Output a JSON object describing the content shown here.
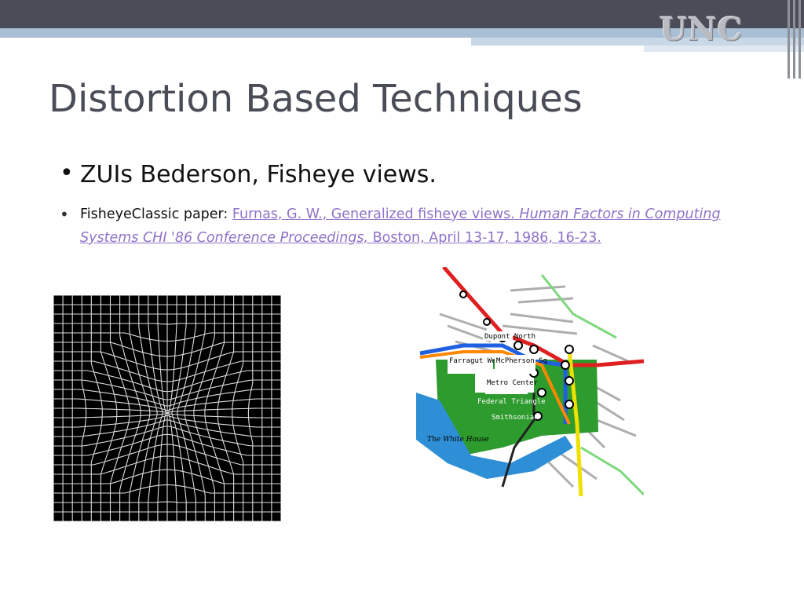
{
  "header": {
    "logo_text": "UNC"
  },
  "slide": {
    "title": "Distortion Based Techniques",
    "bullet1": "ZUIs  Bederson, Fisheye views.",
    "bullet2": {
      "prefix": "FisheyeClassic paper:  ",
      "link_part1": "Furnas, G. W., Generalized fisheye views. ",
      "link_part2_italic": "Human Factors in Computing Systems CHI '86 Conference Proceedings,",
      "link_part3": " Boston, April 13-17, 1986, 16-23."
    }
  },
  "images": {
    "metro_labels": {
      "north": "Dupont North",
      "farragut": "Farragut West",
      "mcpherson": "McPherson Sq",
      "metro_center": "Metro Center",
      "federal_triangle": "Federal Triangle",
      "smithsonian": "Smithsonian",
      "white_house": "The White House"
    }
  },
  "colors": {
    "title_text": "#4a4c57",
    "link": "#8e72c8",
    "top_bar": "#4a4c57",
    "band": "#a8bfd5"
  }
}
